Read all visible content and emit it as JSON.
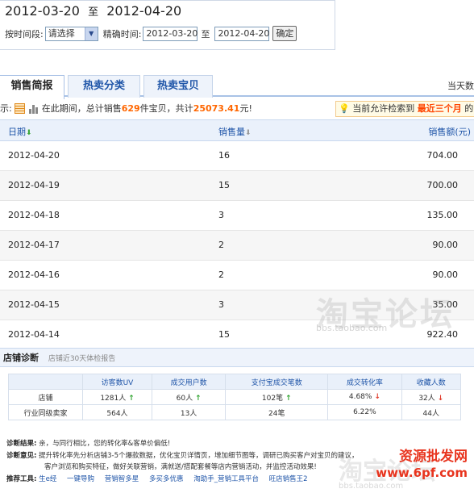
{
  "header": {
    "start": "2012-03-20",
    "sep": "至",
    "end": "2012-04-20"
  },
  "filter": {
    "period_label": "按时间段:",
    "period_value": "请选择",
    "exact_label": "精确时间:",
    "exact_start": "2012-03-20",
    "exact_sep": "至",
    "exact_end": "2012-04-20",
    "confirm": "确定"
  },
  "tabs": [
    "销售简报",
    "热卖分类",
    "热卖宝贝"
  ],
  "today_text": "当天数",
  "summary": {
    "prefix": "示:",
    "text1": "在此期间，总计销售",
    "count": "629",
    "text2": "件宝贝，共计",
    "amount": "25073.41",
    "text3": "元!",
    "notice_text": "当前允许检索到",
    "notice_hl": "最近三个月",
    "notice_tail": "的"
  },
  "table": {
    "col_date": "日期",
    "col_qty": "销售量",
    "col_amount": "销售额(元)",
    "rows": [
      {
        "date": "2012-04-20",
        "qty": "16",
        "amount": "704.00"
      },
      {
        "date": "2012-04-19",
        "qty": "15",
        "amount": "700.00"
      },
      {
        "date": "2012-04-18",
        "qty": "3",
        "amount": "135.00"
      },
      {
        "date": "2012-04-17",
        "qty": "2",
        "amount": "90.00"
      },
      {
        "date": "2012-04-16",
        "qty": "2",
        "amount": "90.00"
      },
      {
        "date": "2012-04-15",
        "qty": "3",
        "amount": "35.00"
      },
      {
        "date": "2012-04-14",
        "qty": "15",
        "amount": "922.40"
      }
    ]
  },
  "watermark": {
    "main": "淘宝论坛",
    "url": "bbs.taobao.com"
  },
  "diagnosis": {
    "title": "店铺诊断",
    "subtitle": "店铺近30天体检报告",
    "headers": [
      "",
      "访客数UV",
      "成交用户数",
      "支付宝成交笔数",
      "成交转化率",
      "收藏人数"
    ],
    "row_shop_label": "店铺",
    "row_shop": [
      "1281人",
      "60人",
      "102笔",
      "4.68%",
      "32人"
    ],
    "row_ind_label": "行业同级卖家",
    "row_ind": [
      "564人",
      "13人",
      "24笔",
      "6.22%",
      "44人"
    ],
    "result_label": "诊断结果:",
    "result_text": "亲，与同行相比，您的转化率&客单价偏低!",
    "advice_label": "诊断意见:",
    "advice_line1": "提升转化率先分析店铺3-5个爆款数据，优化宝贝详情页，增加细节图等，调研已购买客户对宝贝的建议，",
    "advice_line2": "客户浏览和购买特征，做好关联营销，满就送/搭配套餐等店内营销活动，并监控活动效果!",
    "tools_label": "推荐工具:",
    "tools": [
      "生e经",
      "一键导购",
      "营销智多星",
      "多买多优惠",
      "淘助手_营销工具平台",
      "旺店销售王2"
    ]
  },
  "brand": {
    "line1": "资源批发网",
    "line2": "www.6pf.com"
  }
}
